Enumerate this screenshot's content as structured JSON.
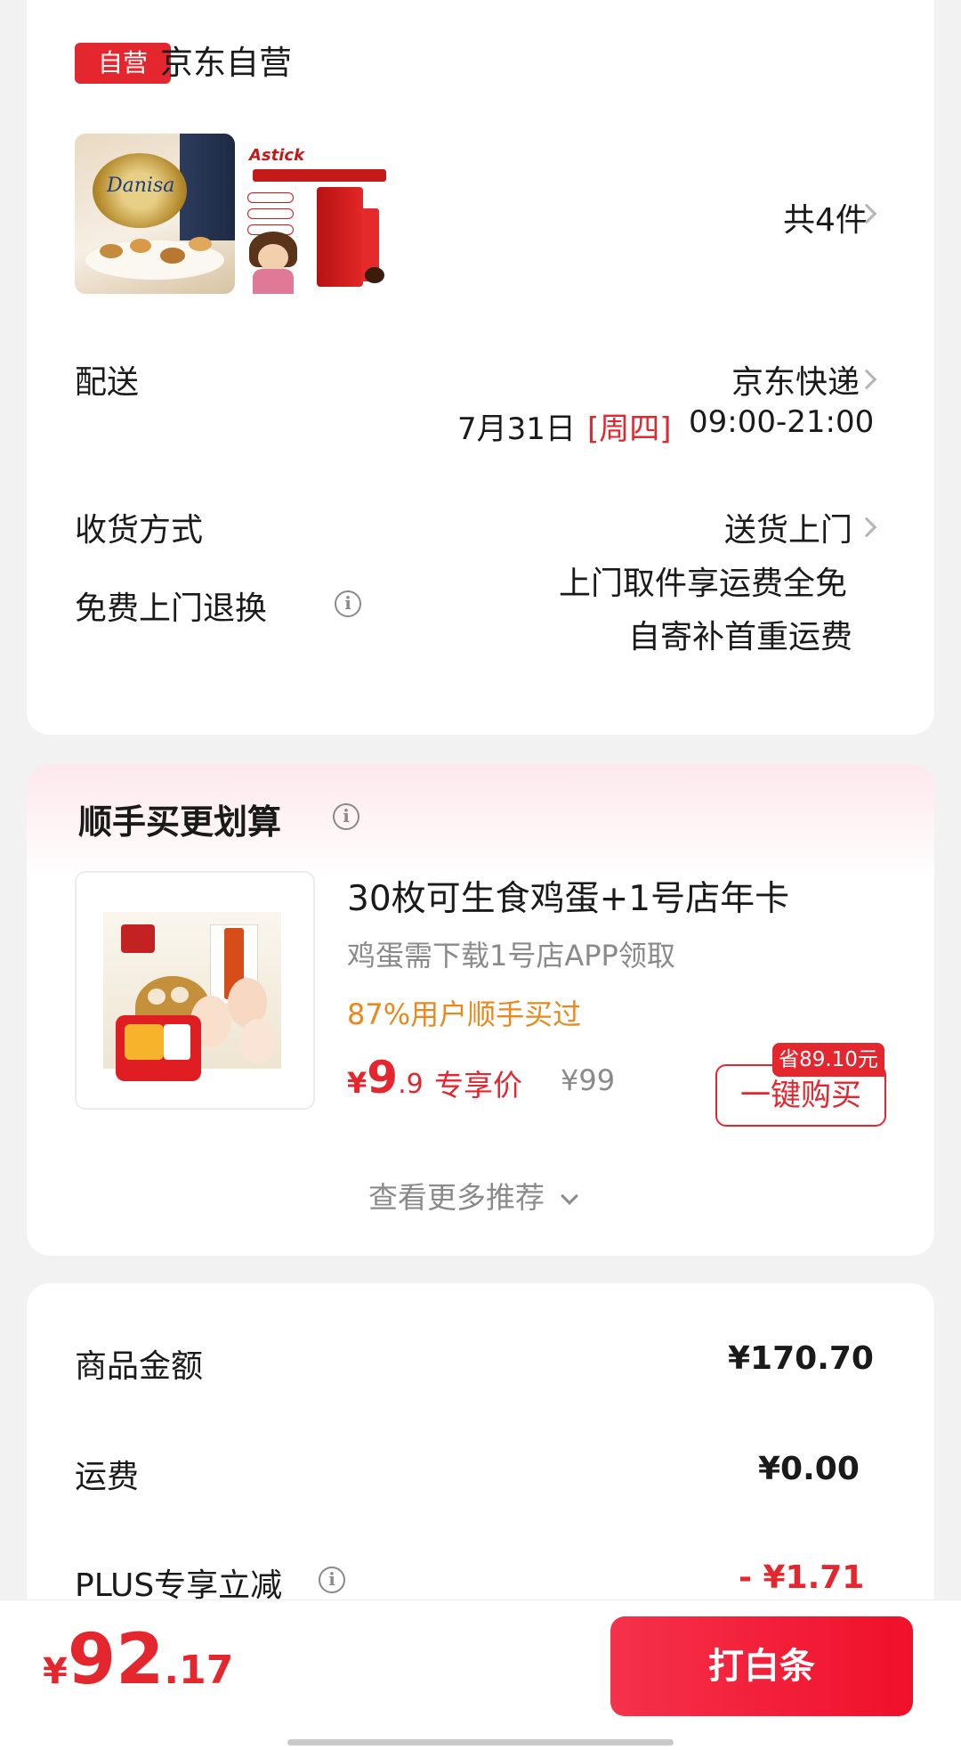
{
  "store": {
    "badge": "自营",
    "name": "京东自营",
    "count_text": "共4件",
    "items": [
      {
        "name": "Danisa",
        "alt": "danisa-cookie-tin"
      },
      {
        "name": "Astick",
        "alt": "astick-wafer-roll"
      }
    ],
    "delivery": {
      "label": "配送",
      "carrier": "京东快递",
      "date": "7月31日",
      "weekday": "[周四]",
      "time": "09:00-21:00"
    },
    "receive": {
      "label": "收货方式",
      "value": "送货上门"
    },
    "returns": {
      "label": "免费上门退换",
      "line1": "上门取件享运费全免",
      "line2": "自寄补首重运费"
    }
  },
  "recommend": {
    "title": "顺手买更划算",
    "product_title": "30枚可生食鸡蛋+1号店年卡",
    "subtitle": "鸡蛋需下载1号店APP领取",
    "social": "87%用户顺手买过",
    "price_symbol": "¥",
    "price_int": "9",
    "price_dec": ".9",
    "price_tag": "专享价",
    "orig_price": "¥99",
    "save_tag": "省89.10元",
    "buy_label": "一键购买",
    "more_label": "查看更多推荐"
  },
  "summary": {
    "rows": [
      {
        "label": "商品金额",
        "value": "¥170.70"
      },
      {
        "label": "运费",
        "value": "¥0.00"
      },
      {
        "label": "PLUS专享立减",
        "value": "- ¥1.71"
      }
    ]
  },
  "footer": {
    "total_symbol": "¥",
    "total_int": "92",
    "total_dec": ".17",
    "pay_label": "打白条"
  },
  "colors": {
    "accent": "#e4262e",
    "orange": "#e8891d",
    "muted": "#8a8a8a"
  }
}
